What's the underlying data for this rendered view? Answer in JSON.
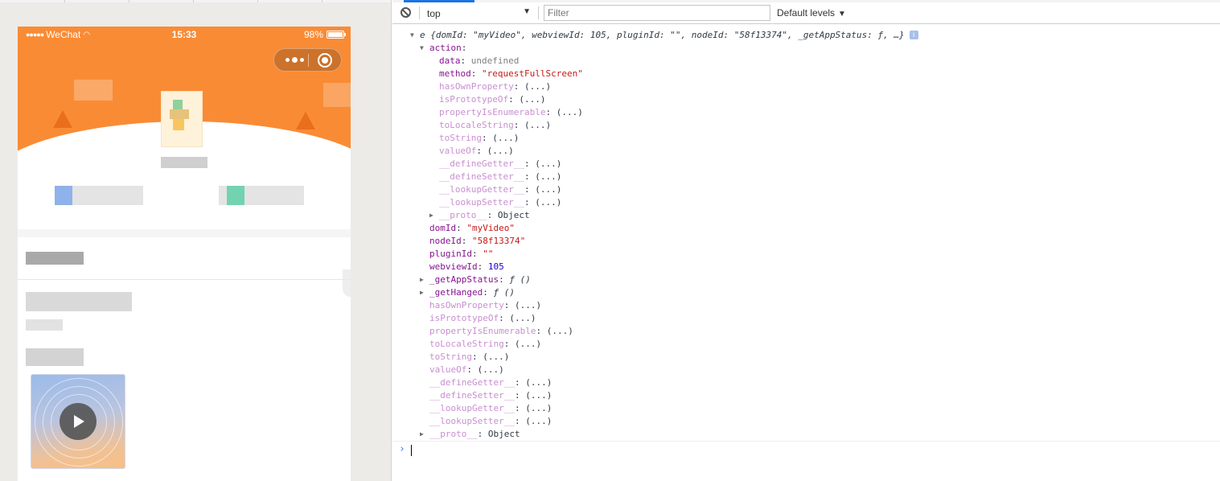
{
  "simulator": {
    "status_bar": {
      "carrier": "WeChat",
      "time": "15:33",
      "battery": "98%",
      "battery_level": 0.98
    },
    "capsule": {
      "more_icon": "more-dots-icon",
      "close_icon": "target-close-icon"
    },
    "video": {
      "play_icon": "play-icon"
    },
    "colors": {
      "header": "#f98b35",
      "background": "#ecebe8"
    }
  },
  "console": {
    "toolbar": {
      "clear_icon": "clear-console-icon",
      "context": "top",
      "filter_placeholder": "Filter",
      "levels": "Default levels"
    },
    "log": {
      "summary": {
        "prefix": "e",
        "text": " {domId: \"myVideo\", webviewId: 105, pluginId: \"\", nodeId: \"58f13374\", _getAppStatus: ƒ, …}",
        "info_badge": "i"
      },
      "action_key": "action",
      "action_props": [
        {
          "key": "data",
          "value": "undefined",
          "type": "undef"
        },
        {
          "key": "method",
          "value": "\"requestFullScreen\"",
          "type": "string"
        },
        {
          "key": "hasOwnProperty",
          "value": "(...)",
          "type": "inherited"
        },
        {
          "key": "isPrototypeOf",
          "value": "(...)",
          "type": "inherited"
        },
        {
          "key": "propertyIsEnumerable",
          "value": "(...)",
          "type": "inherited"
        },
        {
          "key": "toLocaleString",
          "value": "(...)",
          "type": "inherited"
        },
        {
          "key": "toString",
          "value": "(...)",
          "type": "inherited"
        },
        {
          "key": "valueOf",
          "value": "(...)",
          "type": "inherited"
        },
        {
          "key": "__defineGetter__",
          "value": "(...)",
          "type": "inherited"
        },
        {
          "key": "__defineSetter__",
          "value": "(...)",
          "type": "inherited"
        },
        {
          "key": "__lookupGetter__",
          "value": "(...)",
          "type": "inherited"
        },
        {
          "key": "__lookupSetter__",
          "value": "(...)",
          "type": "inherited"
        }
      ],
      "action_proto": {
        "key": "__proto__",
        "value": "Object"
      },
      "root_props": [
        {
          "key": "domId",
          "value": "\"myVideo\"",
          "type": "string"
        },
        {
          "key": "nodeId",
          "value": "\"58f13374\"",
          "type": "string"
        },
        {
          "key": "pluginId",
          "value": "\"\"",
          "type": "string"
        },
        {
          "key": "webviewId",
          "value": "105",
          "type": "number"
        }
      ],
      "root_functions": [
        {
          "key": "_getAppStatus",
          "value": "ƒ ()"
        },
        {
          "key": "_getHanged",
          "value": "ƒ ()"
        }
      ],
      "root_inherited": [
        {
          "key": "hasOwnProperty",
          "value": "(...)"
        },
        {
          "key": "isPrototypeOf",
          "value": "(...)"
        },
        {
          "key": "propertyIsEnumerable",
          "value": "(...)"
        },
        {
          "key": "toLocaleString",
          "value": "(...)"
        },
        {
          "key": "toString",
          "value": "(...)"
        },
        {
          "key": "valueOf",
          "value": "(...)"
        },
        {
          "key": "__defineGetter__",
          "value": "(...)"
        },
        {
          "key": "__defineSetter__",
          "value": "(...)"
        },
        {
          "key": "__lookupGetter__",
          "value": "(...)"
        },
        {
          "key": "__lookupSetter__",
          "value": "(...)"
        }
      ],
      "root_proto": {
        "key": "__proto__",
        "value": "Object"
      }
    },
    "prompt": {
      "chevron": "›"
    },
    "colors": {
      "key": "#881391",
      "inherited_key": "#c88fd0",
      "string": "#c41a16",
      "number": "#1c00cf",
      "accent": "#1a73e8"
    }
  }
}
